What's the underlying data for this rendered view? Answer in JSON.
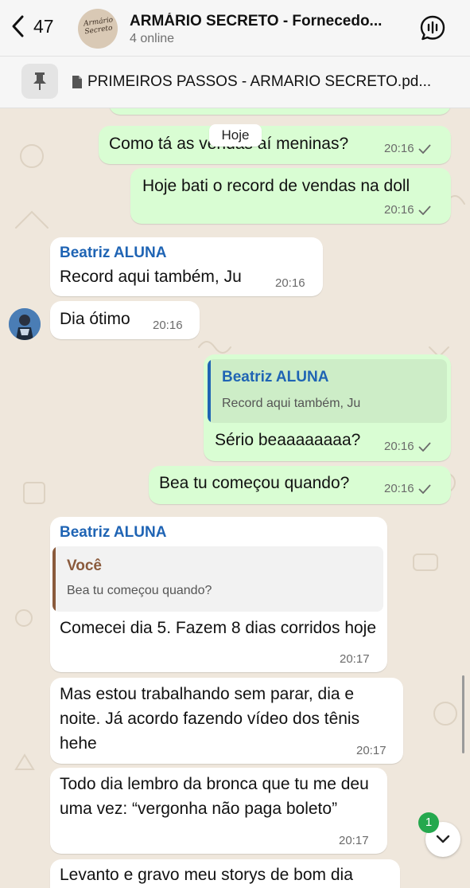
{
  "header": {
    "back_count": "47",
    "title": "ARMÁRIO SECRETO - Fornecedo...",
    "subtitle": "4 online",
    "group_logo_text": "Armário Secreto"
  },
  "pinned": {
    "text": "PRIMEIROS PASSOS - ARMARIO SECRETO.pd..."
  },
  "date_chip": "Hoje",
  "messages": [
    {
      "text": "Como tá as vendas aí meninas?",
      "time": "20:16"
    },
    {
      "text": "Hoje bati o record de vendas na doll",
      "time": "20:16"
    },
    {
      "sender": "Beatriz ALUNA",
      "text": "Record aqui também, Ju",
      "time": "20:16"
    },
    {
      "text": "Dia ótimo",
      "time": "20:16"
    },
    {
      "quote_sender": "Beatriz ALUNA",
      "quote_text": "Record aqui também, Ju",
      "text": "Sério beaaaaaaaa?",
      "time": "20:16"
    },
    {
      "text": "Bea tu começou quando?",
      "time": "20:16"
    },
    {
      "sender": "Beatriz ALUNA",
      "quote_sender": "Você",
      "quote_text": "Bea tu começou quando?",
      "text": "Comecei dia 5. Fazem 8 dias corridos hoje",
      "time": "20:17"
    },
    {
      "text": "Mas estou trabalhando sem parar, dia e noite. Já acordo fazendo vídeo dos tênis hehe",
      "time": "20:17"
    },
    {
      "text": "Todo dia lembro da bronca que tu me deu uma vez: “vergonha não paga boleto”",
      "time": "20:17"
    },
    {
      "text": "Levanto e gravo meu storys de bom dia"
    }
  ],
  "unread_badge": "1",
  "colors": {
    "outgoing_bubble": "#d9fdd3",
    "incoming_bubble": "#ffffff",
    "sender_name": "#1f64b4",
    "quote_you": "#8a5a3c",
    "badge": "#25a84e"
  }
}
